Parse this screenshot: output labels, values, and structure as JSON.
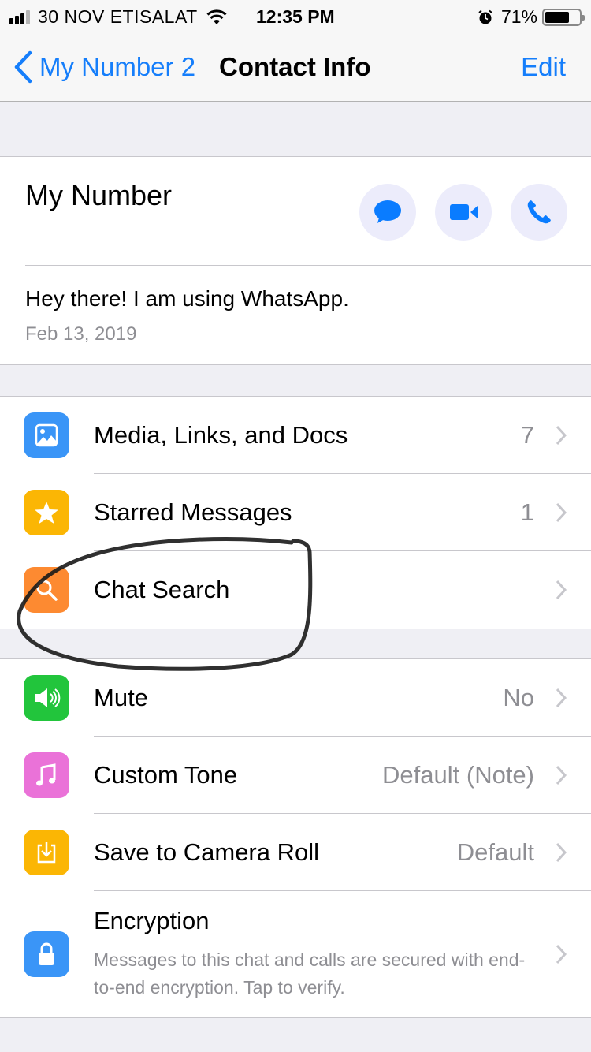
{
  "status_bar": {
    "carrier": "30 NOV ETISALAT",
    "time": "12:35 PM",
    "battery_percent_label": "71%",
    "battery_level": 0.71,
    "signal_bars_active": 3,
    "signal_bars_total": 4
  },
  "nav": {
    "back_label": "My Number 2",
    "title": "Contact Info",
    "edit_label": "Edit",
    "accent_color": "#157efb"
  },
  "profile": {
    "name": "My Number",
    "actions": [
      {
        "name": "message",
        "icon": "message-bubble-icon"
      },
      {
        "name": "video-call",
        "icon": "video-camera-icon"
      },
      {
        "name": "voice-call",
        "icon": "phone-icon"
      }
    ],
    "about": "Hey there! I am using WhatsApp.",
    "about_date": "Feb 13, 2019"
  },
  "section1": [
    {
      "label": "Media, Links, and Docs",
      "value": "7",
      "icon": "photo-icon",
      "color": "#3a95f7"
    },
    {
      "label": "Starred Messages",
      "value": "1",
      "icon": "star-icon",
      "color": "#fbb604"
    },
    {
      "label": "Chat Search",
      "value": "",
      "icon": "search-icon",
      "color": "#fd8a31"
    }
  ],
  "section2": [
    {
      "label": "Mute",
      "value": "No",
      "icon": "speaker-icon",
      "color": "#22c53c"
    },
    {
      "label": "Custom Tone",
      "value": "Default (Note)",
      "icon": "music-note-icon",
      "color": "#ea72d8"
    },
    {
      "label": "Save to Camera Roll",
      "value": "Default",
      "icon": "download-icon",
      "color": "#fbb604"
    },
    {
      "label": "Encryption",
      "subtitle": "Messages to this chat and calls are secured with end-to-end encryption. Tap to verify.",
      "icon": "lock-icon",
      "color": "#3a95f7"
    }
  ],
  "annotation": {
    "description": "hand-drawn circle around Chat Search",
    "color": "#1a1a1a"
  }
}
